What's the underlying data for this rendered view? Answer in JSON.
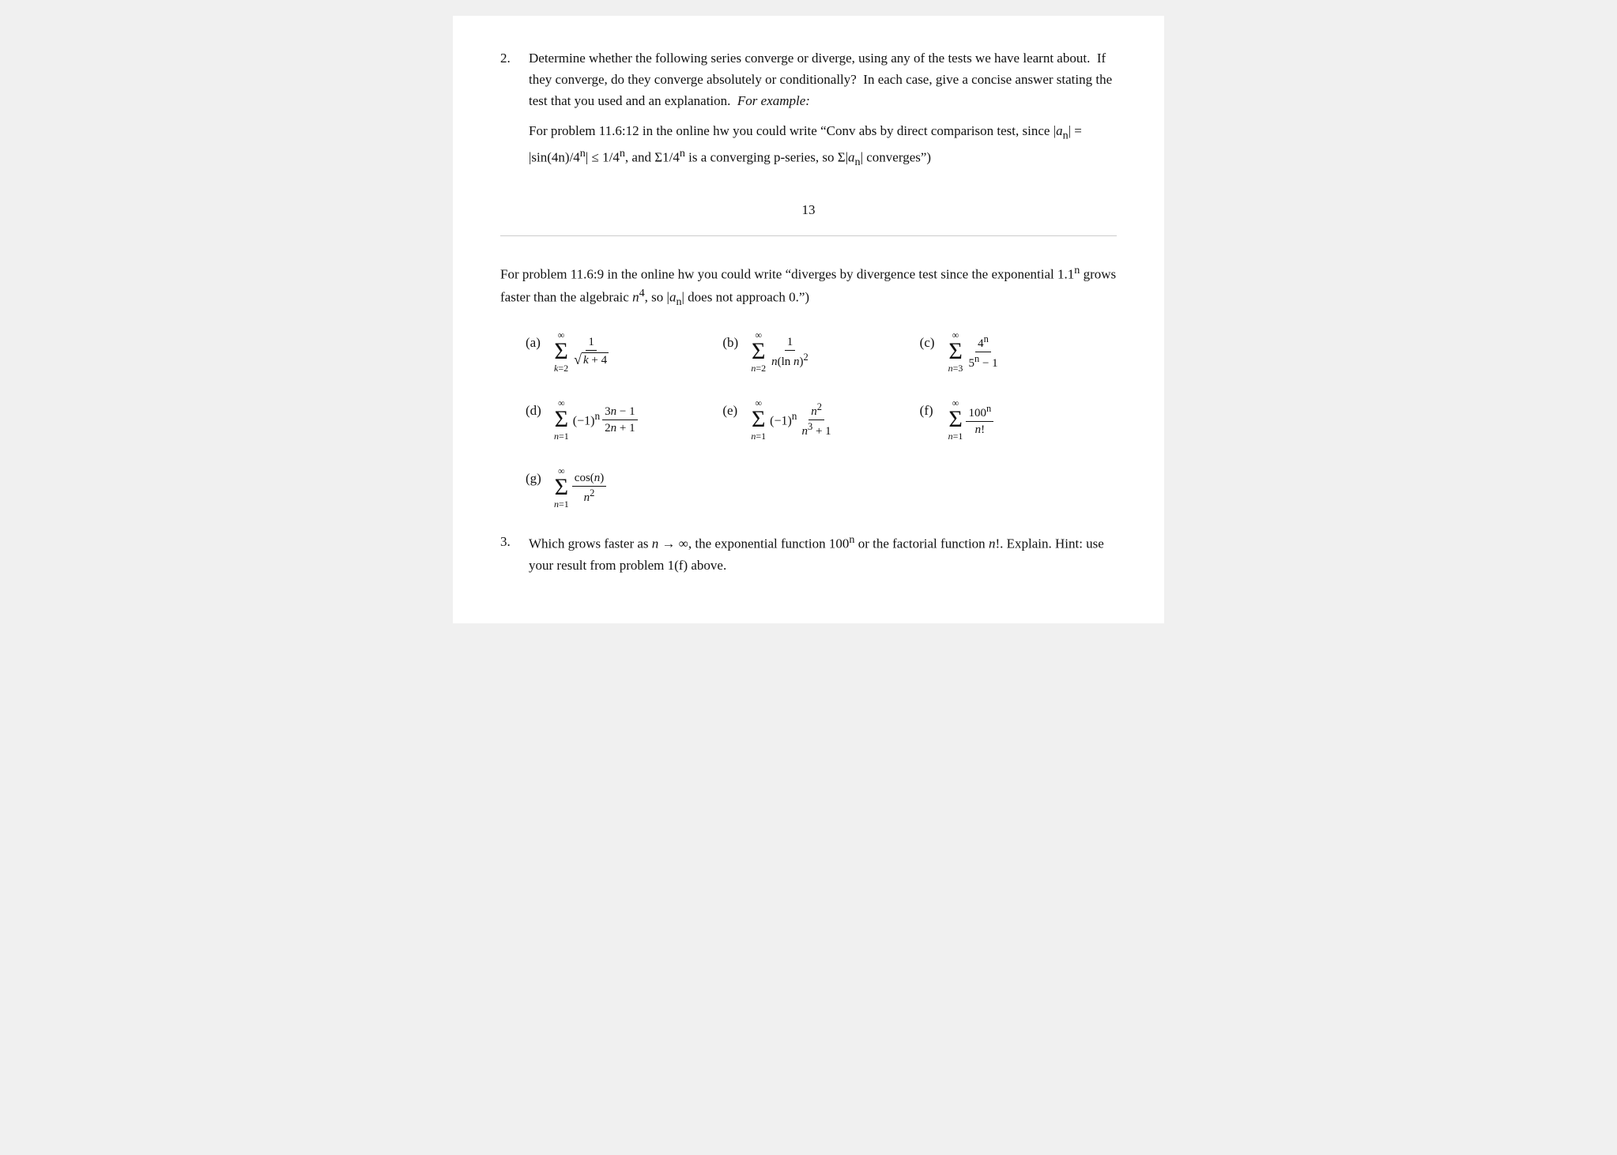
{
  "problem2": {
    "number": "2.",
    "text1": "Determine whether the following series converge or diverge, using any of the tests we have learnt about.  If they converge, do they converge absolutely or conditionally?  In each case, give a concise answer stating the test that you used and an explanation. ",
    "italic": "For example:",
    "example_text": "For problem 11.6:12 in the online hw you could write “Conv abs by direct comparison test, since |aₙ| = |sin(4n)/4ⁿ| ≤ 1/4ⁿ, and Σ1/4ⁿ is a converging p-series, so Σ|aₙ| converges”)",
    "page_number": "13",
    "for_problem2_text": "For problem 11.6:9 in the online hw you could write “diverges by divergence test since the exponential 1.1ⁿ grows faster than the algebraic n⁴, so |aₙ| does not approach 0.”)",
    "series": {
      "a_label": "(a)",
      "b_label": "(b)",
      "c_label": "(c)",
      "d_label": "(d)",
      "e_label": "(e)",
      "f_label": "(f)",
      "g_label": "(g)"
    }
  },
  "problem3": {
    "number": "3.",
    "text": "Which grows faster as n → ∞, the exponential function 100ⁿ or the factorial function n!. Explain. Hint: use your result from problem 1(f) above."
  }
}
